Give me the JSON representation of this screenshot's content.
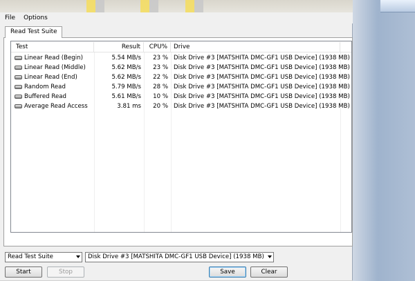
{
  "menu": {
    "items": [
      "File",
      "Options"
    ]
  },
  "tab": {
    "label": "Read Test Suite"
  },
  "table": {
    "columns": {
      "test": "Test",
      "result": "Result",
      "cpu": "CPU%",
      "drive": "Drive"
    },
    "rows": [
      {
        "test": "Linear Read (Begin)",
        "result": "5.54 MB/s",
        "cpu": "23 %",
        "drive": "Disk Drive #3  [MATSHITA DMC-GF1 USB Device]  (1938 MB)"
      },
      {
        "test": "Linear Read (Middle)",
        "result": "5.62 MB/s",
        "cpu": "23 %",
        "drive": "Disk Drive #3  [MATSHITA DMC-GF1 USB Device]  (1938 MB)"
      },
      {
        "test": "Linear Read (End)",
        "result": "5.62 MB/s",
        "cpu": "22 %",
        "drive": "Disk Drive #3  [MATSHITA DMC-GF1 USB Device]  (1938 MB)"
      },
      {
        "test": "Random Read",
        "result": "5.79 MB/s",
        "cpu": "28 %",
        "drive": "Disk Drive #3  [MATSHITA DMC-GF1 USB Device]  (1938 MB)"
      },
      {
        "test": "Buffered Read",
        "result": "5.61 MB/s",
        "cpu": "10 %",
        "drive": "Disk Drive #3  [MATSHITA DMC-GF1 USB Device]  (1938 MB)"
      },
      {
        "test": "Average Read Access",
        "result": "3.81 ms",
        "cpu": "20 %",
        "drive": "Disk Drive #3  [MATSHITA DMC-GF1 USB Device]  (1938 MB)"
      }
    ]
  },
  "controls": {
    "suite_select": "Read Test Suite",
    "drive_select": "Disk Drive #3  [MATSHITA DMC-GF1 USB Device]  (1938 MB)",
    "start_label": "Start",
    "stop_label": "Stop",
    "save_label": "Save",
    "clear_label": "Clear"
  }
}
